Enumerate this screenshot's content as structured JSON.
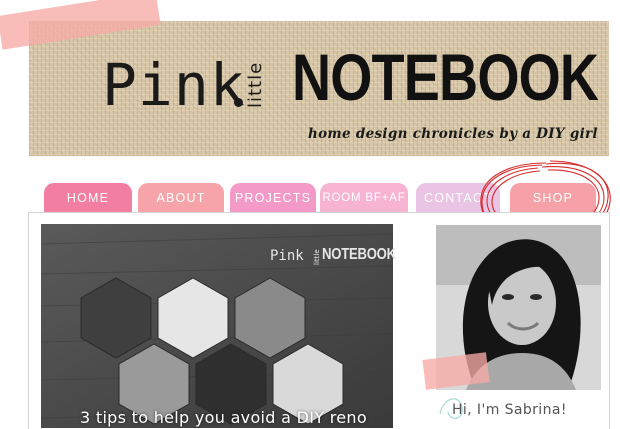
{
  "header": {
    "logo": {
      "pink": "Pink",
      "little": "little",
      "notebook": "NOTEBOOK"
    },
    "tagline": "home design chronicles by a DIY girl"
  },
  "nav": {
    "tabs": [
      {
        "label": "HOME",
        "color": "#f27ea1"
      },
      {
        "label": "ABOUT",
        "color": "#f6a4aa"
      },
      {
        "label": "PROJECTS",
        "color": "#f39ac8"
      },
      {
        "label": "ROOM BF+AF",
        "color": "#f7b4d2"
      },
      {
        "label": "CONTACT",
        "color": "#e9c4e4"
      },
      {
        "label": "SHOP",
        "color": "#f5a1a7"
      }
    ]
  },
  "post": {
    "title": "3 tips to help you avoid a DIY reno",
    "watermark": {
      "pink": "Pink",
      "little": "little",
      "notebook": "NOTEBOOK"
    }
  },
  "sidebar": {
    "greeting": "Hi, I'm Sabrina!"
  },
  "colors": {
    "accent_pink": "#f27ea1",
    "shop_circle": "#d62a2a",
    "burlap": "#d9c8a9"
  }
}
